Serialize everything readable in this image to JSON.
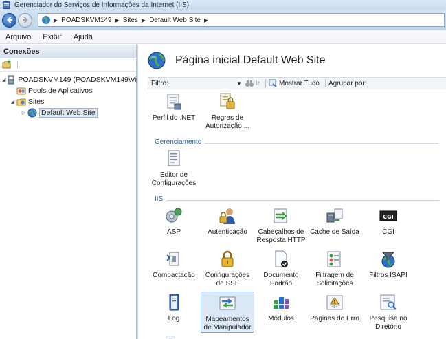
{
  "window": {
    "title": "Gerenciador do Serviços de Informações da Internet (IIS)"
  },
  "address": {
    "crumbs": [
      "POADSKVM149",
      "Sites",
      "Default Web Site"
    ]
  },
  "menu": [
    "Arquivo",
    "Exibir",
    "Ajuda"
  ],
  "connections": {
    "title": "Conexões",
    "tree": [
      {
        "label": "POADSKVM149 (POADSKVM149\\Virt",
        "level": 0,
        "expander": "◢"
      },
      {
        "label": "Pools de Aplicativos",
        "level": 1,
        "expander": ""
      },
      {
        "label": "Sites",
        "level": 1,
        "expander": "◢"
      },
      {
        "label": "Default Web Site",
        "level": 2,
        "expander": "▷",
        "selected": true
      }
    ]
  },
  "main": {
    "title": "Página inicial Default Web Site",
    "filter": {
      "label": "Filtro:",
      "go": "Ir",
      "show_all": "Mostrar Tudo",
      "group_by": "Agrupar por:"
    },
    "top_features": [
      "Perfil do .NET",
      "Regras de Autorização ..."
    ],
    "sections": {
      "gerenciamento": {
        "title": "Gerenciamento",
        "features": [
          "Editor de Configurações"
        ]
      },
      "iis": {
        "title": "IIS",
        "features": [
          "ASP",
          "Autenticação",
          "Cabeçalhos de Resposta HTTP",
          "Cache de Saída",
          "CGI",
          "Compactação",
          "Configurações de SSL",
          "Documento Padrão",
          "Filtragem de Solicitações",
          "Filtros ISAPI",
          "Log",
          "Mapeamentos de Manipulador",
          "Módulos",
          "Páginas de Erro",
          "Pesquisa no Diretório"
        ]
      }
    }
  },
  "colors": {
    "accent": "#2c5f9e",
    "selection": "#dbe8f7",
    "title_gradient": "#c9dcef"
  }
}
